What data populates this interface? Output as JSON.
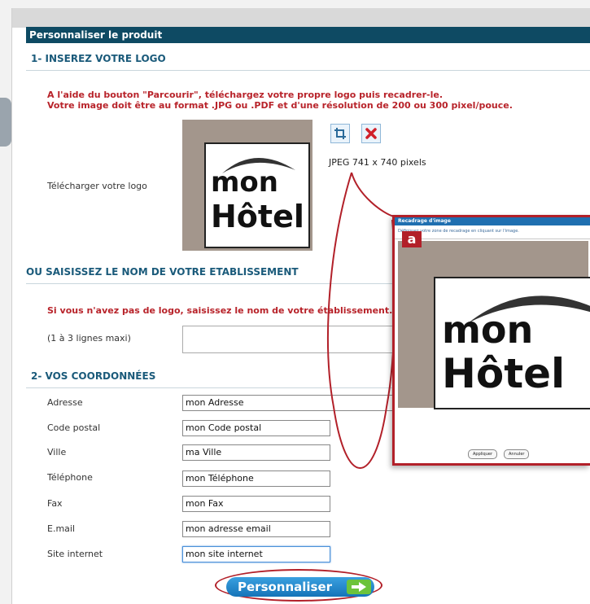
{
  "header": {
    "title": "Personnaliser le produit"
  },
  "section1": {
    "title": "1- INSEREZ VOTRE LOGO",
    "instruction_line1": "A l'aide du bouton \"Parcourir\", téléchargez votre propre logo puis recadrer-le.",
    "instruction_line2": "Votre image doit être au format .JPG ou .PDF et d'une résolution de 200 ou 300 pixel/pouce.",
    "upload_label": "Télécharger votre logo",
    "logo_line1": "mon",
    "logo_line2": "Hôtel",
    "image_info": "JPEG 741 x 740 pixels",
    "icons": [
      "crop-icon",
      "delete-icon"
    ]
  },
  "section_alt": {
    "title": "OU SAISISSEZ LE NOM DE VOTRE ETABLISSEMENT",
    "instruction": "Si vous n'avez pas de logo, saisissez le nom de votre établissement.",
    "lines_label": "(1 à 3 lignes maxi)"
  },
  "section2": {
    "title": "2- VOS COORDONNÉES",
    "fields": [
      {
        "label": "Adresse",
        "value": "mon Adresse"
      },
      {
        "label": "Code postal",
        "value": "mon Code postal"
      },
      {
        "label": "Ville",
        "value": "ma Ville"
      },
      {
        "label": "Téléphone",
        "value": "mon Téléphone"
      },
      {
        "label": "Fax",
        "value": "mon Fax"
      },
      {
        "label": "E.mail",
        "value": "mon adresse email"
      },
      {
        "label": "Site internet",
        "value": "mon site internet"
      }
    ]
  },
  "submit": {
    "label": "Personnaliser"
  },
  "popup": {
    "title": "Recadrage d'image",
    "info": "Définissez votre zone de recadrage en cliquant sur l'image.",
    "marker": "a",
    "logo_line1": "mon",
    "logo_line2": "Hôtel",
    "apply_label": "Appliquer",
    "cancel_label": "Annuler"
  },
  "colors": {
    "header": "#0e4a63",
    "section_title": "#1a5a7a",
    "warning": "#b22029",
    "button": "#1f86cc",
    "arrow": "#6cc33b"
  }
}
